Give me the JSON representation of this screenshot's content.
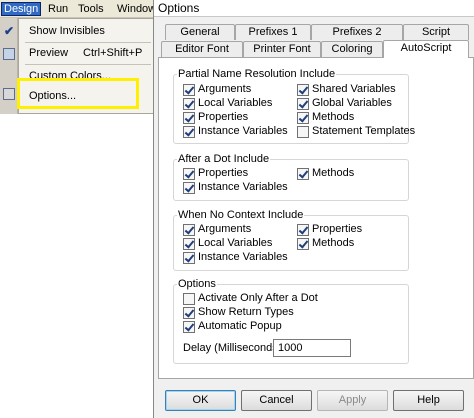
{
  "menubar": {
    "items": [
      {
        "label": "Design",
        "active": true
      },
      {
        "label": "Run",
        "active": false
      },
      {
        "label": "Tools",
        "active": false
      },
      {
        "label": "Window",
        "active": false
      }
    ]
  },
  "design_menu": {
    "items": [
      {
        "label": "Show Invisibles",
        "checked": true,
        "shortcut": ""
      },
      {
        "label": "Preview",
        "shortcut": "Ctrl+Shift+P"
      },
      {
        "label": "Custom Colors..."
      },
      {
        "label": "Options..."
      }
    ]
  },
  "dialog": {
    "title": "Options",
    "tabs_row1": [
      {
        "label": "General"
      },
      {
        "label": "Prefixes 1"
      },
      {
        "label": "Prefixes 2"
      },
      {
        "label": "Script"
      }
    ],
    "tabs_row2": [
      {
        "label": "Editor Font"
      },
      {
        "label": "Printer Font"
      },
      {
        "label": "Coloring"
      },
      {
        "label": "AutoScript",
        "selected": true
      }
    ],
    "groups": {
      "partial": {
        "label": "Partial Name Resolution Include",
        "items": [
          {
            "label": "Arguments",
            "checked": true
          },
          {
            "label": "Shared Variables",
            "checked": true
          },
          {
            "label": "Local Variables",
            "checked": true
          },
          {
            "label": "Global Variables",
            "checked": true
          },
          {
            "label": "Properties",
            "checked": true
          },
          {
            "label": "Methods",
            "checked": true
          },
          {
            "label": "Instance Variables",
            "checked": true
          },
          {
            "label": "Statement Templates",
            "checked": false
          }
        ]
      },
      "after_dot": {
        "label": "After a Dot Include",
        "items": [
          {
            "label": "Properties",
            "checked": true
          },
          {
            "label": "Methods",
            "checked": true
          },
          {
            "label": "Instance Variables",
            "checked": true
          }
        ]
      },
      "no_context": {
        "label": "When No Context Include",
        "items": [
          {
            "label": "Arguments",
            "checked": true
          },
          {
            "label": "Properties",
            "checked": true
          },
          {
            "label": "Local Variables",
            "checked": true
          },
          {
            "label": "Methods",
            "checked": true
          },
          {
            "label": "Instance Variables",
            "checked": true
          }
        ]
      },
      "options": {
        "label": "Options",
        "items": [
          {
            "label": "Activate Only After a Dot",
            "checked": false
          },
          {
            "label": "Show Return Types",
            "checked": true
          },
          {
            "label": "Automatic Popup",
            "checked": true
          }
        ],
        "delay_label": "Delay (Milliseconds):",
        "delay_value": "1000"
      }
    },
    "buttons": {
      "ok": "OK",
      "cancel": "Cancel",
      "apply": "Apply",
      "help": "Help"
    }
  },
  "colors": {
    "menu_highlight": "#ffef00",
    "menu_active": "#316ac5"
  }
}
